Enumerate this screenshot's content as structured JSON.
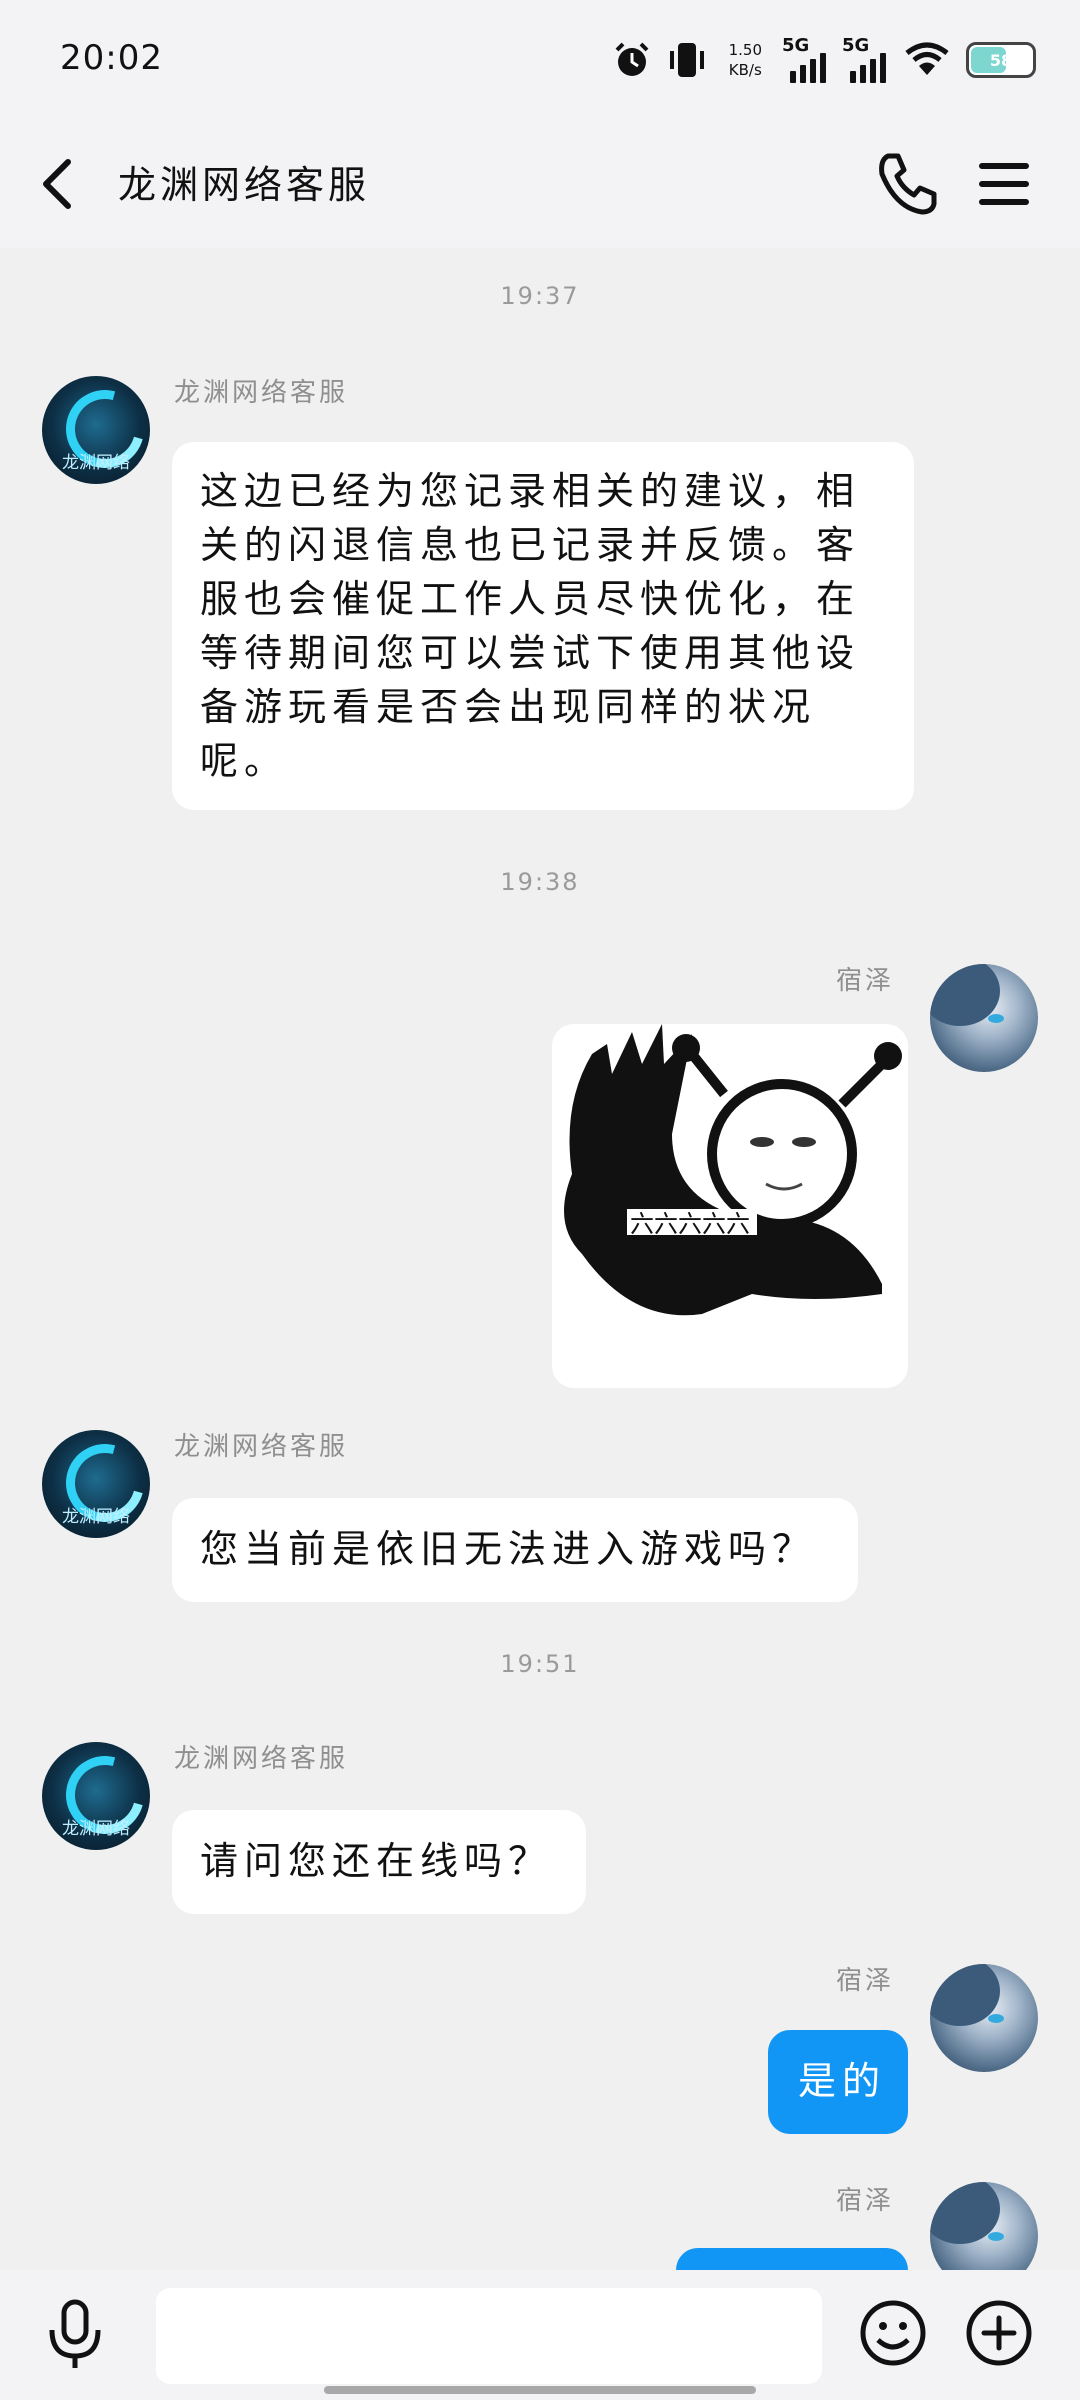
{
  "status_bar": {
    "time": "20:02",
    "net_speed_value": "1.50",
    "net_speed_unit": "KB/s",
    "sim1_label": "5G",
    "sim2_label": "5G",
    "battery": "58"
  },
  "header": {
    "title": "龙渊网络客服"
  },
  "messages": [
    {
      "timestamp": "19:37"
    },
    {
      "sender": "龙渊网络客服",
      "avatar_text": "龙渊网络",
      "text": "这边已经为您记录相关的建议，相关的闪退信息也已记录并反馈。客服也会催促工作人员尽快优化，在等待期间您可以尝试下使用其他设备游玩看是否会出现同样的状况呢。"
    },
    {
      "timestamp": "19:38"
    },
    {
      "sender": "宿泽",
      "image_caption": "六六六六六"
    },
    {
      "sender": "龙渊网络客服",
      "avatar_text": "龙渊网络",
      "text": "您当前是依旧无法进入游戏吗？"
    },
    {
      "timestamp": "19:51"
    },
    {
      "sender": "龙渊网络客服",
      "avatar_text": "龙渊网络",
      "text": "请问您还在线吗？"
    },
    {
      "sender": "宿泽",
      "text": "是的"
    },
    {
      "sender": "宿泽"
    }
  ],
  "colors": {
    "accent_blue": "#1296f5",
    "background": "#f0f0f0"
  }
}
